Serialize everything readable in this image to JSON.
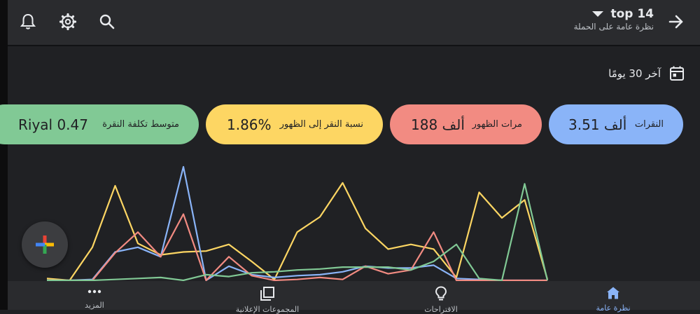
{
  "header": {
    "title": "top 14",
    "subtitle": "نظرة عامة على الحملة"
  },
  "date_range": {
    "label": "آخر 30 يومًا"
  },
  "metrics": [
    {
      "label": "النقرات",
      "value": "3.51 ألف",
      "color": "#8ab4f8"
    },
    {
      "label": "مرات الظهور",
      "value": "188 ألف",
      "color": "#f28b82"
    },
    {
      "label": "نسبة النقر إلى الظهور",
      "value": "1.86%",
      "color": "#fdd663"
    },
    {
      "label": "متوسط تكلفة النقرة",
      "value": "Riyal 0.47",
      "color": "#81c995"
    }
  ],
  "nav": {
    "items": [
      {
        "label": "نظرة عامة",
        "icon": "home-icon",
        "active": true
      },
      {
        "label": "الاقتراحات",
        "icon": "lightbulb-icon",
        "active": false
      },
      {
        "label": "المجموعات الإعلانية",
        "icon": "ad-groups-icon",
        "active": false
      },
      {
        "label": "المزيد",
        "icon": "more-icon",
        "active": false
      }
    ]
  },
  "chart_data": {
    "type": "line",
    "title": "",
    "xlabel": "",
    "ylabel": "",
    "ylim": [
      0,
      1
    ],
    "grid": false,
    "x": [
      1,
      2,
      3,
      4,
      5,
      6,
      7,
      8,
      9,
      10,
      11,
      12,
      13,
      14,
      15,
      16,
      17,
      18,
      19,
      20,
      21,
      22,
      23
    ],
    "series": [
      {
        "color": "#fdd663",
        "values": [
          0.02,
          0.0,
          0.35,
          1.0,
          0.39,
          0.27,
          0.3,
          0.31,
          0.38,
          0.2,
          0.01,
          0.51,
          0.67,
          1.03,
          0.55,
          0.33,
          0.38,
          0.33,
          0.03,
          0.93,
          0.66,
          0.85,
          0.01
        ]
      },
      {
        "color": "#8ab4f8",
        "values": [
          0.0,
          0.0,
          0.01,
          0.3,
          0.35,
          0.25,
          1.2,
          0.0,
          0.15,
          0.06,
          0.03,
          0.05,
          0.06,
          0.09,
          0.15,
          0.13,
          0.13,
          0.16,
          0.02,
          0.01,
          0.0,
          0.0,
          0.0
        ]
      },
      {
        "color": "#f28b82",
        "values": [
          0.0,
          0.0,
          0.0,
          0.29,
          0.51,
          0.25,
          0.7,
          0.0,
          0.25,
          0.05,
          0.0,
          0.01,
          0.03,
          0.01,
          0.15,
          0.07,
          0.11,
          0.51,
          0.0,
          0.0,
          0.0,
          0.0,
          0.0
        ]
      },
      {
        "color": "#81c995",
        "values": [
          0.0,
          0.0,
          0.0,
          0.01,
          0.02,
          0.03,
          0.0,
          0.06,
          0.04,
          0.08,
          0.09,
          0.11,
          0.12,
          0.14,
          0.14,
          0.14,
          0.11,
          0.2,
          0.38,
          0.02,
          0.0,
          1.02,
          0.0
        ]
      }
    ]
  }
}
